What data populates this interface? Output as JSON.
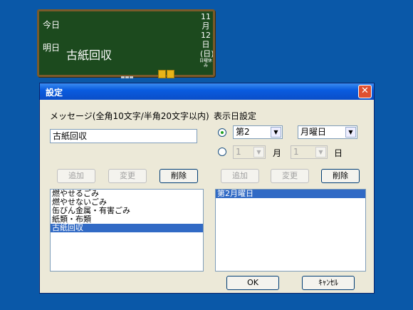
{
  "board": {
    "today_label": "今日",
    "tomorrow_label": "明日",
    "message": "古紙回収",
    "date_vertical": "11月12日(日)",
    "tiny_text": "日曜休み"
  },
  "dialog": {
    "title": "設定",
    "close_symbol": "✕",
    "message_section_label": "メッセージ(全角10文字/半角20文字以内)",
    "message_value": "古紙回収",
    "left_buttons": {
      "add": "追加",
      "change": "変更",
      "delete": "削除"
    },
    "message_list": [
      "燃やせるごみ",
      "燃やせないごみ",
      "缶びん金属・有害ごみ",
      "紙類・布類",
      "古紙回収"
    ],
    "message_selected_index": 4,
    "date_section_label": "表示日設定",
    "week_combo": {
      "value": "第2",
      "arrow": "▼"
    },
    "weekday_combo": {
      "value": "月曜日",
      "arrow": "▼"
    },
    "month_combo": {
      "value": "1",
      "arrow": "▼"
    },
    "month_label": "月",
    "day_combo": {
      "value": "1",
      "arrow": "▼"
    },
    "day_label": "日",
    "right_buttons": {
      "add": "追加",
      "change": "変更",
      "delete": "削除"
    },
    "date_list": [
      "第2月曜日"
    ],
    "date_selected_index": 0,
    "ok_label": "OK",
    "cancel_label": "ｷｬﾝｾﾙ"
  },
  "colors": {
    "desktop": "#0a58a8",
    "board": "#1c4a1e",
    "frame": "#7a5a2a",
    "selection": "#316ac5"
  }
}
